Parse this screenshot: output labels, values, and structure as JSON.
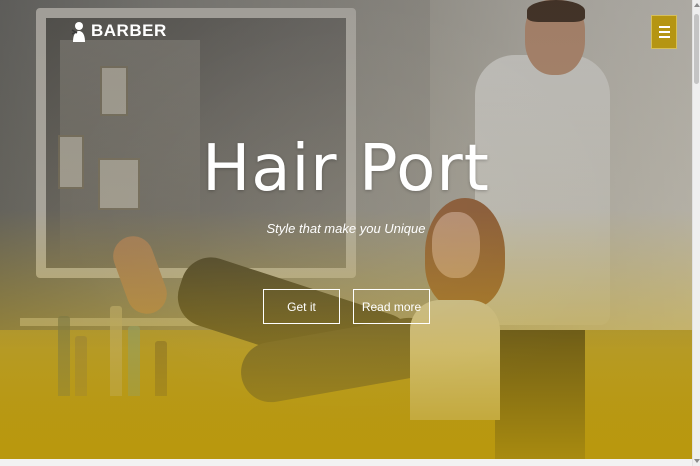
{
  "header": {
    "logo_text": "BARBER",
    "logo_icon": "scissors-head-icon",
    "menu_icon": "hamburger-menu-icon"
  },
  "hero": {
    "title": "Hair Port",
    "subtitle": "Style that make you Unique",
    "primary_button": "Get it",
    "secondary_button": "Read more"
  },
  "colors": {
    "accent": "#b59512",
    "text": "#ffffff"
  }
}
